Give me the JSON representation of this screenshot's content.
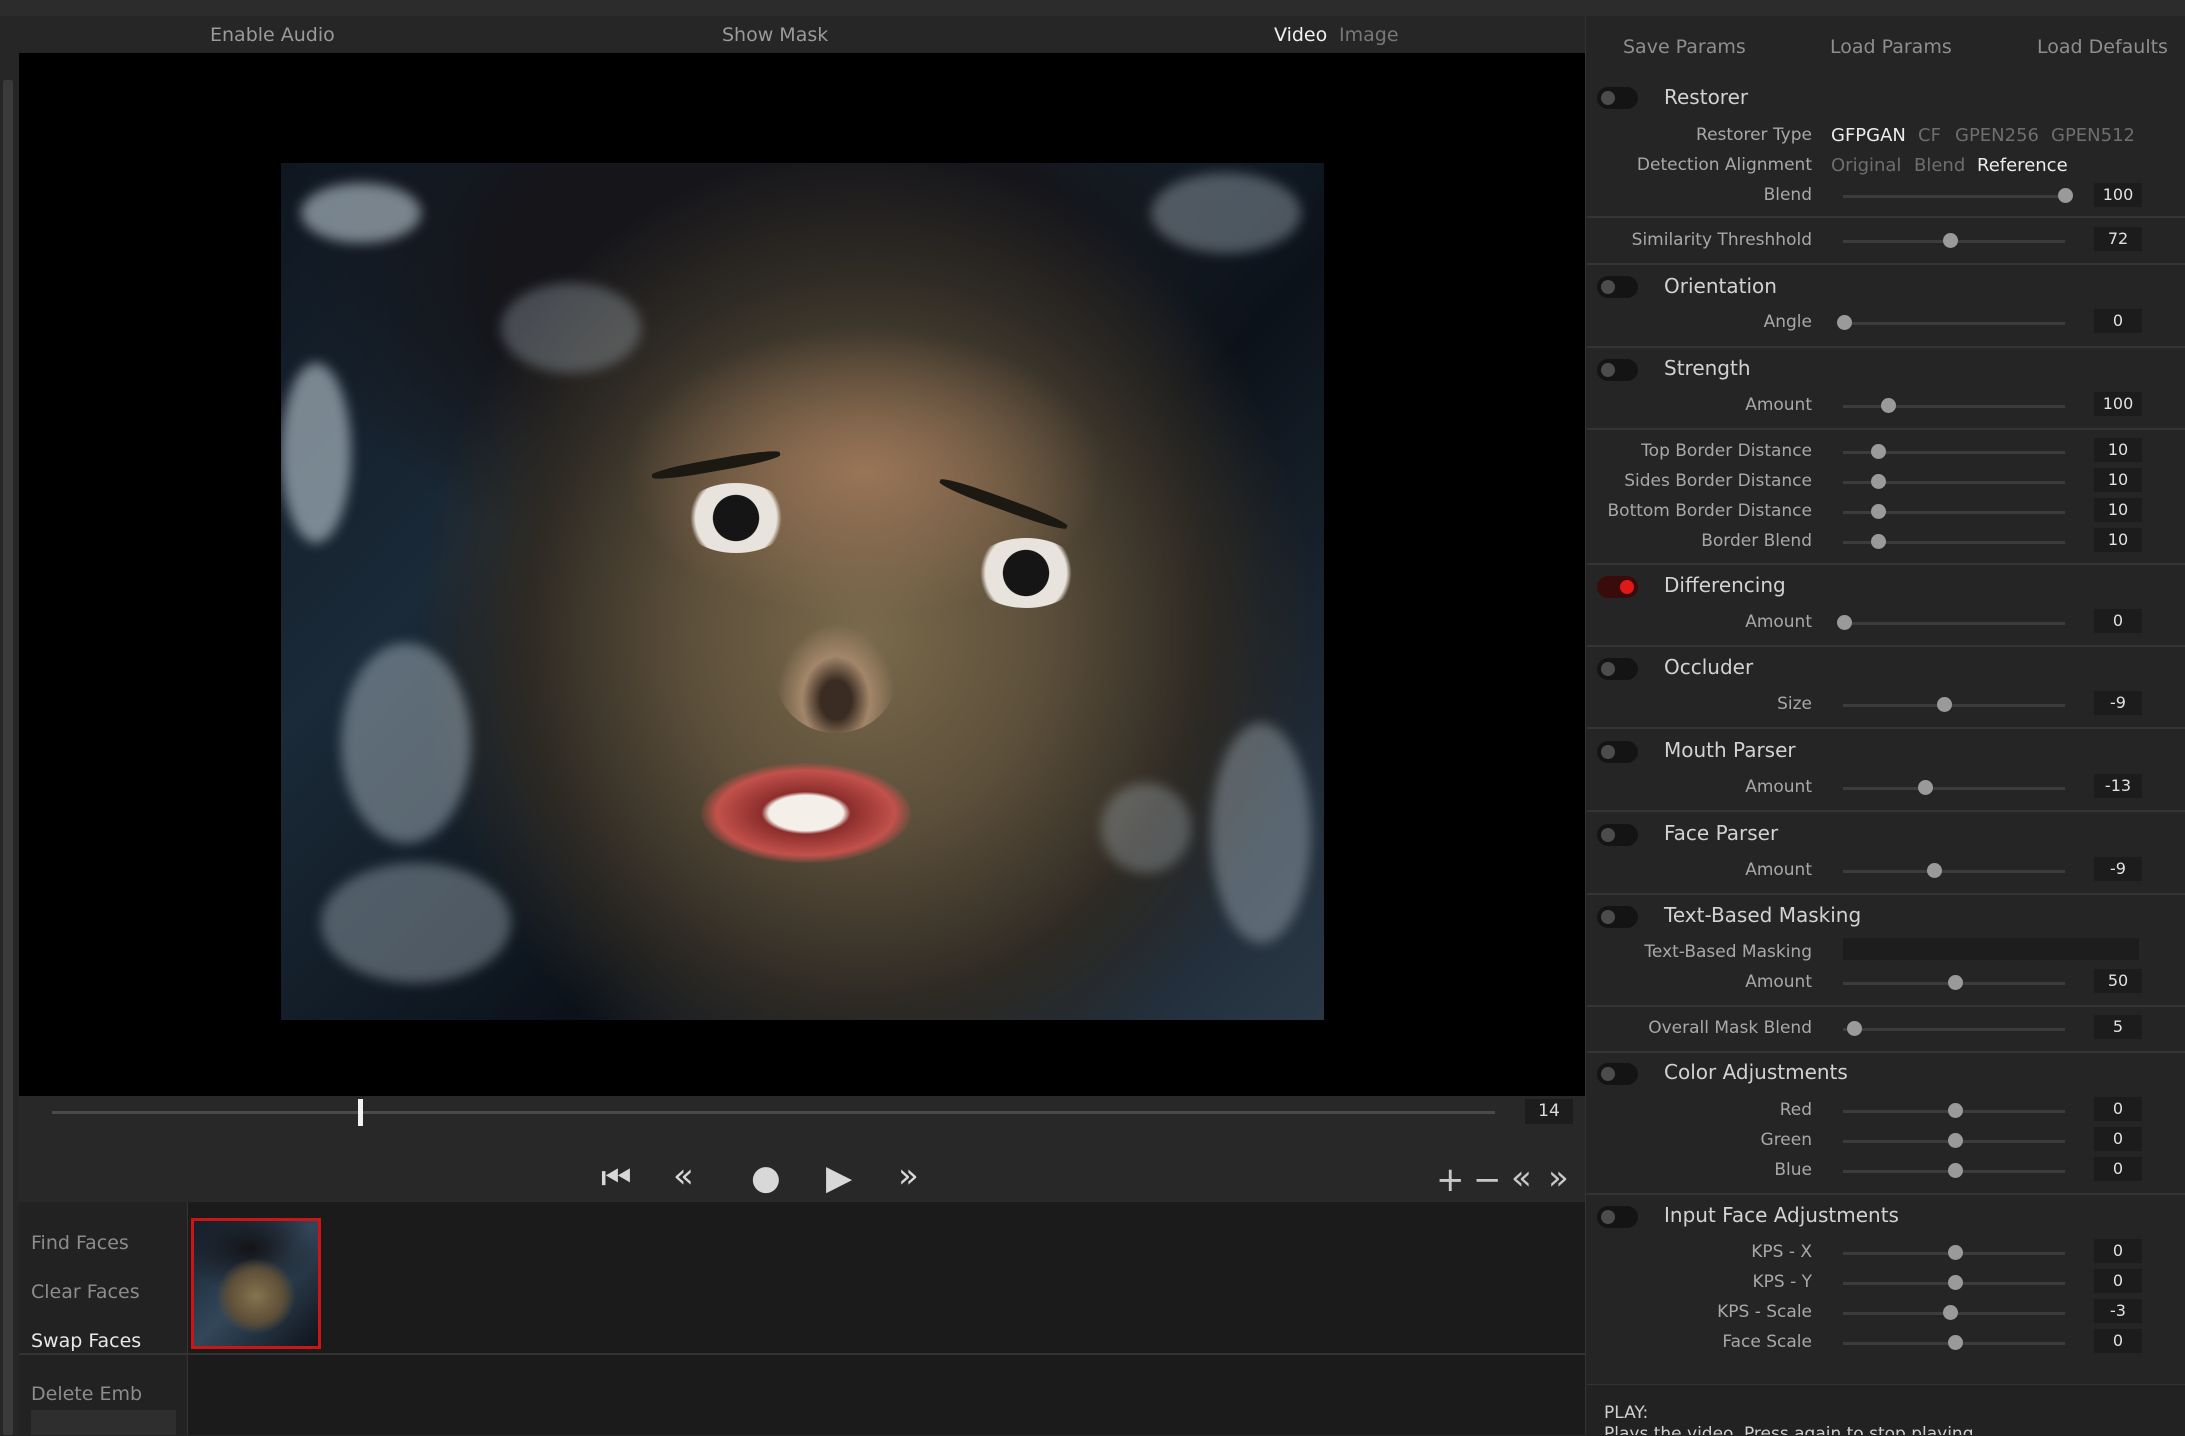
{
  "toolbar": {
    "enable_audio": "Enable Audio",
    "show_mask": "Show Mask",
    "mode_video": "Video",
    "mode_image": "Image"
  },
  "timeline": {
    "frame": "14",
    "position_fraction": 0.21
  },
  "faces": {
    "find": "Find Faces",
    "clear": "Clear Faces",
    "swap": "Swap Faces",
    "delete_emb": "Delete Emb"
  },
  "panel": {
    "save_params": "Save Params",
    "load_params": "Load Params",
    "load_defaults": "Load Defaults"
  },
  "restorer": {
    "title": "Restorer",
    "type_label": "Restorer Type",
    "types": [
      "GFPGAN",
      "CF",
      "GPEN256",
      "GPEN512"
    ],
    "type_selected": "GFPGAN",
    "align_label": "Detection Alignment",
    "aligns": [
      "Original",
      "Blend",
      "Reference"
    ],
    "align_selected": "Reference",
    "blend_label": "Blend",
    "blend": "100"
  },
  "similarity": {
    "label": "Similarity Threshhold",
    "value": "72"
  },
  "orientation": {
    "title": "Orientation",
    "label": "Angle",
    "value": "0"
  },
  "strength": {
    "title": "Strength",
    "label": "Amount",
    "value": "100"
  },
  "borders": {
    "top_label": "Top Border Distance",
    "top": "10",
    "sides_label": "Sides Border Distance",
    "sides": "10",
    "bottom_label": "Bottom Border Distance",
    "bottom": "10",
    "blend_label": "Border Blend",
    "blend": "10"
  },
  "differencing": {
    "title": "Differencing",
    "label": "Amount",
    "value": "0",
    "enabled": true
  },
  "occluder": {
    "title": "Occluder",
    "label": "Size",
    "value": "-9"
  },
  "mouth_parser": {
    "title": "Mouth Parser",
    "label": "Amount",
    "value": "-13"
  },
  "face_parser": {
    "title": "Face Parser",
    "label": "Amount",
    "value": "-9"
  },
  "text_masking": {
    "title": "Text-Based Masking",
    "field_label": "Text-Based Masking",
    "field_value": "",
    "amount_label": "Amount",
    "amount": "50"
  },
  "overall_mask_blend": {
    "label": "Overall Mask Blend",
    "value": "5"
  },
  "color_adjust": {
    "title": "Color Adjustments",
    "red_label": "Red",
    "red": "0",
    "green_label": "Green",
    "green": "0",
    "blue_label": "Blue",
    "blue": "0"
  },
  "input_face": {
    "title": "Input Face Adjustments",
    "kpsx_label": "KPS - X",
    "kpsx": "0",
    "kpsy_label": "KPS - Y",
    "kpsy": "0",
    "kpss_label": "KPS - Scale",
    "kpss": "-3",
    "face_scale_label": "Face Scale",
    "face_scale": "0"
  },
  "status": {
    "title": "PLAY:",
    "message": "Plays the video. Press again to stop playing"
  },
  "colors": {
    "accent": "#e01818",
    "bg": "#252525",
    "toggle_off": "#141414"
  }
}
